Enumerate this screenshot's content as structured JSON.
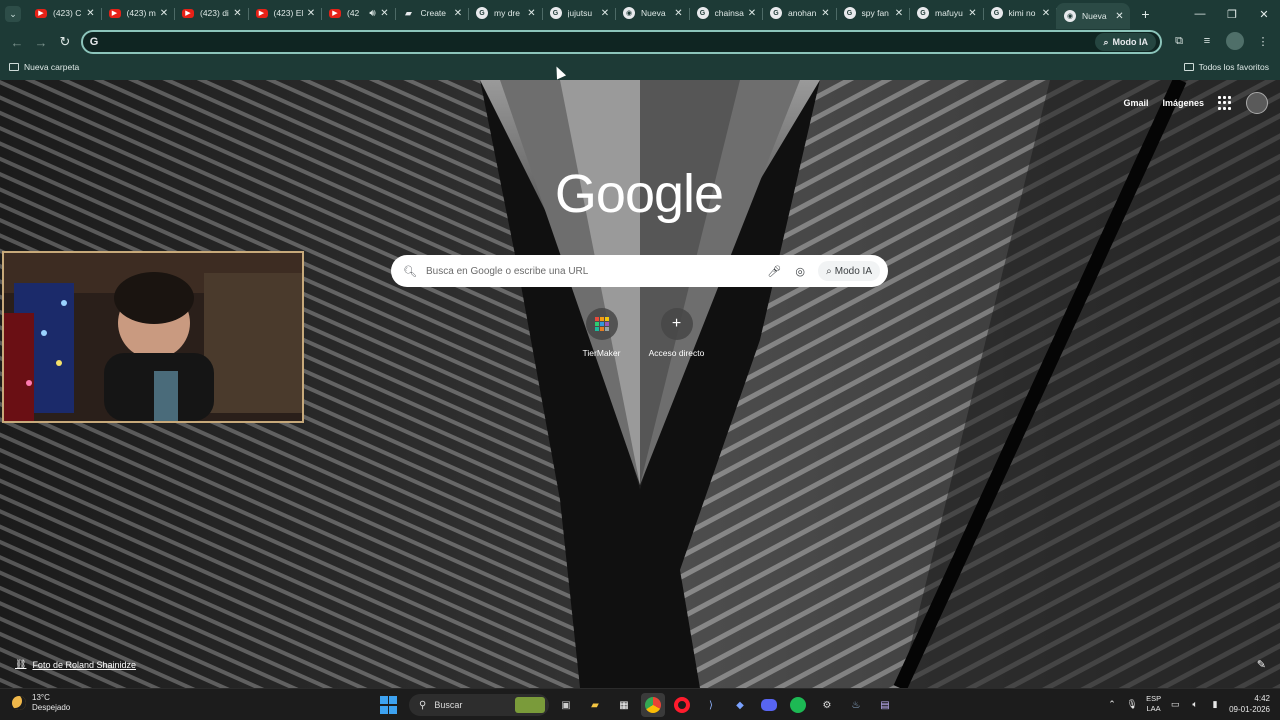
{
  "browser": {
    "tabs": [
      {
        "label": "(423) C",
        "favicon": "youtube-icon",
        "active": false
      },
      {
        "label": "(423) m",
        "favicon": "youtube-icon",
        "active": false
      },
      {
        "label": "(423) di",
        "favicon": "youtube-icon",
        "active": false
      },
      {
        "label": "(423) El",
        "favicon": "youtube-icon",
        "active": false
      },
      {
        "label": "(42",
        "favicon": "youtube-icon",
        "active": false,
        "audio": true
      },
      {
        "label": "Create",
        "favicon": "doc-icon",
        "active": false
      },
      {
        "label": "my dre",
        "favicon": "google-icon",
        "active": false
      },
      {
        "label": "jujutsu",
        "favicon": "google-icon",
        "active": false
      },
      {
        "label": "Nueva",
        "favicon": "chrome-icon",
        "active": false
      },
      {
        "label": "chainsa",
        "favicon": "google-icon",
        "active": false
      },
      {
        "label": "anohan",
        "favicon": "google-icon",
        "active": false
      },
      {
        "label": "spy fan",
        "favicon": "google-icon",
        "active": false
      },
      {
        "label": "mafuyu",
        "favicon": "google-icon",
        "active": false
      },
      {
        "label": "kimi no",
        "favicon": "google-icon",
        "active": false
      },
      {
        "label": "Nueva",
        "favicon": "chrome-icon",
        "active": true
      }
    ],
    "omnibox": {
      "value": "",
      "placeholder": "",
      "modo_ia_label": "Modo IA"
    },
    "bookmarks": {
      "left_folder": "Nueva carpeta",
      "right_folder": "Todos los favoritos"
    }
  },
  "ntp": {
    "top_links": {
      "gmail": "Gmail",
      "images": "Imágenes"
    },
    "logo_text": "Google",
    "search": {
      "placeholder": "Busca en Google o escribe una URL",
      "modo_ia_label": "Modo IA"
    },
    "shortcuts": [
      {
        "label": "TierMaker",
        "icon": "tiermaker-icon"
      },
      {
        "label": "Acceso directo",
        "icon": "plus-icon"
      }
    ],
    "photo_credit": "Foto de Roland Shainidze"
  },
  "taskbar": {
    "weather": {
      "temp": "13°C",
      "condition": "Despejado"
    },
    "search_label": "Buscar",
    "lang": {
      "line1": "ESP",
      "line2": "LAA"
    },
    "clock": {
      "time": "4:42",
      "date": "09-01-2026"
    }
  },
  "colors": {
    "chrome_bg": "#1d3a36",
    "omnibox_border": "#8cc5bb",
    "taskbar_bg": "#1c1c1c",
    "youtube_red": "#e62117",
    "windows_blue": "#3da2f0"
  }
}
